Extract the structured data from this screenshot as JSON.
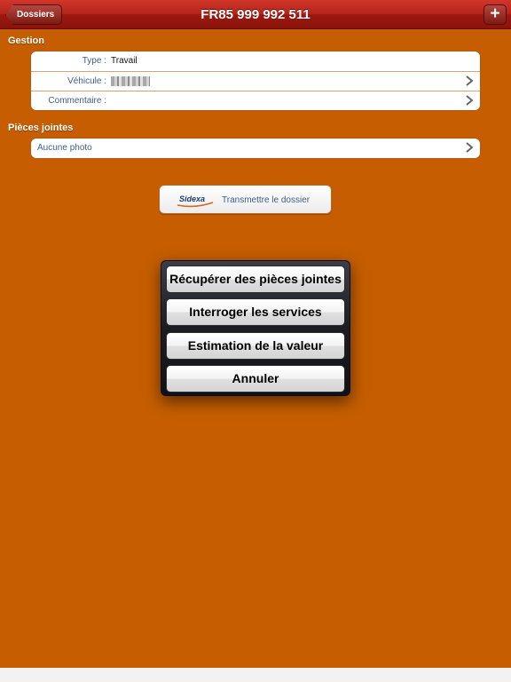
{
  "navbar": {
    "title": "FR85 999 992 511",
    "back_label": "Dossiers",
    "add_label": "+"
  },
  "sections": {
    "gestion": "Gestion",
    "pieces": "Pièces jointes"
  },
  "gestion_rows": {
    "type_label": "Type :",
    "type_value": "Travail",
    "vehicule_label": "Véhicule :",
    "commentaire_label": "Commentaire :"
  },
  "pieces_row": {
    "label": "Aucune photo"
  },
  "transmit": {
    "logo_text": "Sidexa",
    "label": "Transmettre le dossier"
  },
  "action_sheet": {
    "items": [
      "Récupérer des pièces jointes",
      "Interroger les services",
      "Estimation de la valeur",
      "Annuler"
    ]
  },
  "colors": {
    "background": "#c65e01",
    "navbar": "#b4241a",
    "link_text": "#3c5d8c"
  }
}
